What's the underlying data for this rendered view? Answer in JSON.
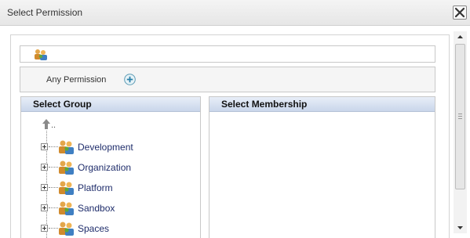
{
  "window": {
    "title": "Select Permission"
  },
  "permission": {
    "any_label": "Any Permission"
  },
  "group_panel": {
    "header": "Select Group",
    "up_label": "..",
    "nodes": [
      {
        "label": "Development"
      },
      {
        "label": "Organization"
      },
      {
        "label": "Platform"
      },
      {
        "label": "Sandbox"
      },
      {
        "label": "Spaces"
      }
    ]
  },
  "membership_panel": {
    "header": "Select Membership"
  },
  "icons": {
    "close": "close-icon",
    "group": "group-icon",
    "add": "plus-icon",
    "up": "up-level-icon"
  },
  "colors": {
    "header_gradient": "#c9d6ea",
    "node_text": "#1f2d6b",
    "plus": "#2a7fa8"
  }
}
